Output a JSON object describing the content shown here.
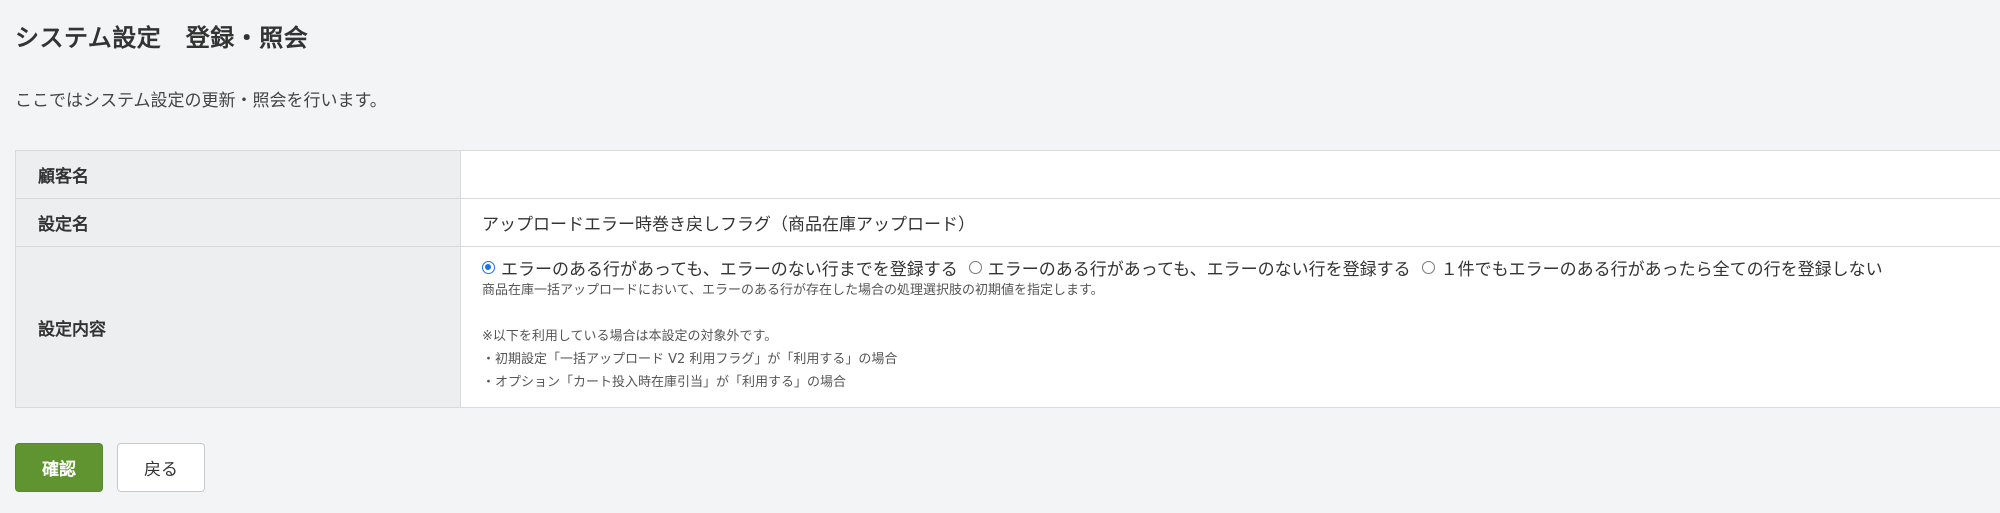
{
  "page": {
    "title": "システム設定　登録・照会",
    "description": "ここではシステム設定の更新・照会を行います。"
  },
  "table": {
    "customer_label": "顧客名",
    "customer_value": "",
    "setting_name_label": "設定名",
    "setting_name_value": "アップロードエラー時巻き戻しフラグ（商品在庫アップロード）",
    "setting_content_label": "設定内容",
    "options": [
      {
        "label": "エラーのある行があっても、エラーのない行までを登録する",
        "checked": true
      },
      {
        "label": "エラーのある行があっても、エラーのない行を登録する",
        "checked": false
      },
      {
        "label": "１件でもエラーのある行があったら全ての行を登録しない",
        "checked": false
      }
    ],
    "help_main": "商品在庫一括アップロードにおいて、エラーのある行が存在した場合の処理選択肢の初期値を指定します。",
    "help_note_title": "※以下を利用している場合は本設定の対象外です。",
    "help_note_items": [
      "・初期設定「一括アップロード V2 利用フラグ」が「利用する」の場合",
      "・オプション「カート投入時在庫引当」が「利用する」の場合"
    ]
  },
  "buttons": {
    "confirm_label": "確認",
    "back_label": "戻る"
  },
  "colors": {
    "confirm_bg": "#5f9431",
    "radio_accent": "#1a73e8",
    "label_bg": "#eceef0"
  }
}
